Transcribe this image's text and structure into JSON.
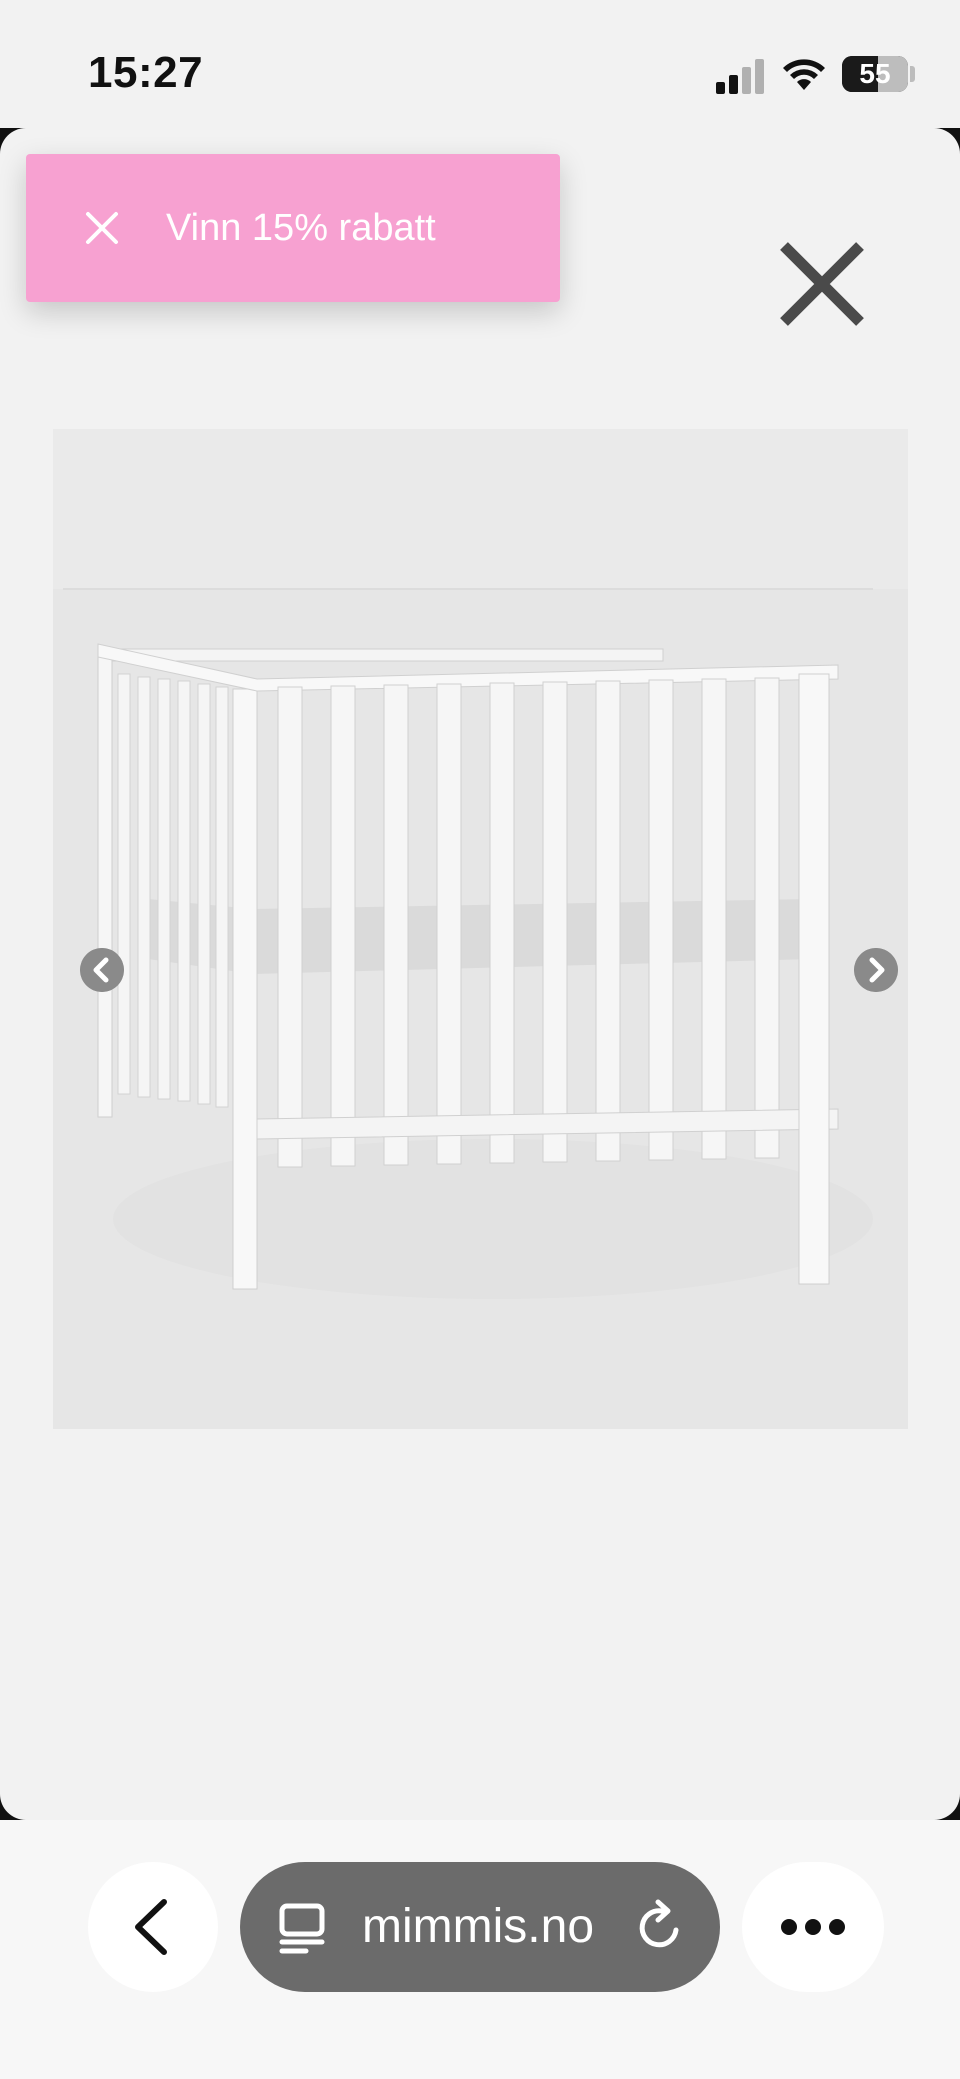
{
  "status_bar": {
    "time": "15:27",
    "battery_percent": 55,
    "battery_label": "55",
    "signal_icon": "cellular-signal-icon",
    "wifi_icon": "wifi-icon"
  },
  "promo": {
    "text": "Vinn 15% rabatt",
    "close_icon": "close-icon",
    "background_color": "#f7a1d1"
  },
  "modal": {
    "close_icon": "close-icon"
  },
  "gallery": {
    "image_description_icon": "baby-crib-product-photo",
    "prev_icon": "chevron-left-icon",
    "next_icon": "chevron-right-icon"
  },
  "browser": {
    "url": "mimmis.no",
    "back_icon": "chevron-left-icon",
    "reader_icon": "page-menu-icon",
    "reload_icon": "reload-icon",
    "more_icon": "more-icon"
  }
}
